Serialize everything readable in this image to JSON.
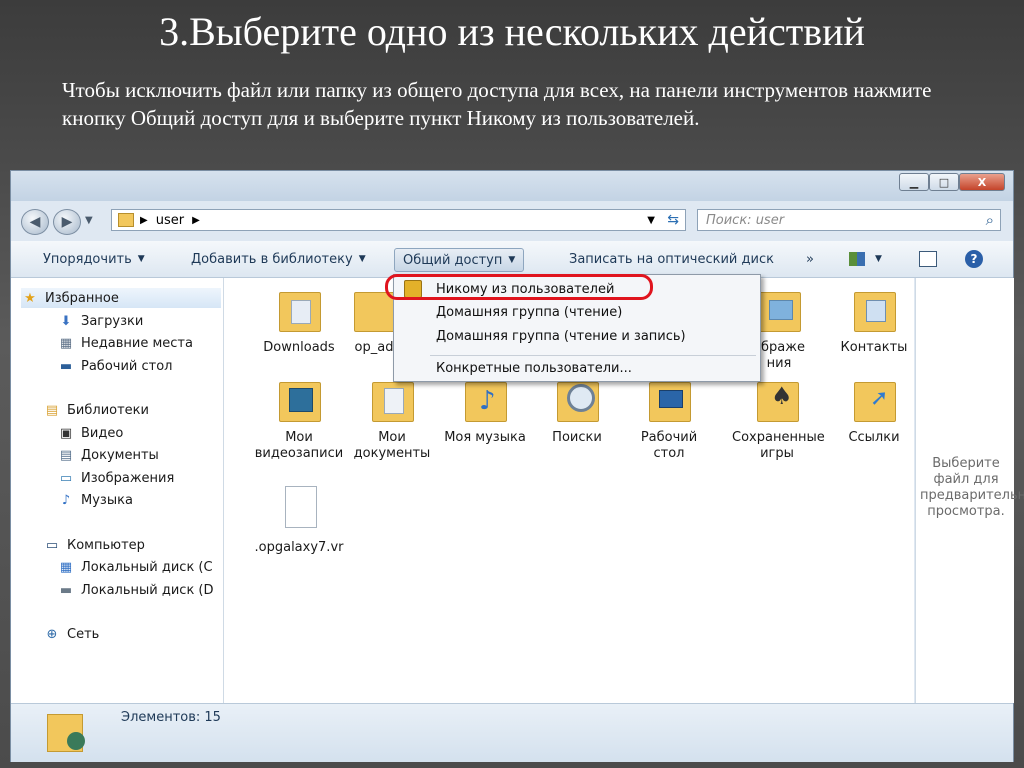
{
  "slide": {
    "title": "3.Выберите одно из нескольких действий",
    "text": "Чтобы исключить файл или папку из общего доступа для всех, на панели инструментов нажмите кнопку Общий доступ для и выберите пункт Никому из пользователей."
  },
  "window": {
    "buttons": {
      "minimize": "▁",
      "maximize": "□",
      "close": "X"
    },
    "address": {
      "path": "user",
      "search_placeholder": "Поиск: user"
    },
    "toolbar": {
      "organize": "Упорядочить",
      "add_library": "Добавить в библиотеку",
      "share": "Общий доступ",
      "burn": "Записать на оптический диск",
      "more": "»"
    },
    "nav": {
      "favorites": "Избранное",
      "downloads": "Загрузки",
      "recent": "Недавние места",
      "desktop": "Рабочий стол",
      "libraries": "Библиотеки",
      "video": "Видео",
      "documents": "Документы",
      "images": "Изображения",
      "music": "Музыка",
      "computer": "Компьютер",
      "disk_c": "Локальный диск (C",
      "disk_d": "Локальный диск (D",
      "network": "Сеть"
    },
    "items": {
      "downloads": "Downloads",
      "op_ad": "op_ad",
      "images_partial": "ображе ния",
      "contacts": "Контакты",
      "my_videos": "Мои видеозаписи",
      "my_documents": "Мои документы",
      "my_music": "Моя музыка",
      "searches": "Поиски",
      "desktop": "Рабочий стол",
      "saved_games": "Сохраненные игры",
      "links": "Ссылки",
      "file": ".opgalaxy7.vr"
    },
    "preview": "Выберите файл для предварительного просмотра.",
    "status": "Элементов: 15"
  },
  "menu": {
    "nobody": "Никому из пользователей",
    "homegroup_read": "Домашняя группа (чтение)",
    "homegroup_rw": "Домашняя группа (чтение и запись)",
    "specific": "Конкретные пользователи..."
  },
  "colors": {
    "highlight": "#e0141e",
    "folder": "#f2c75c"
  }
}
